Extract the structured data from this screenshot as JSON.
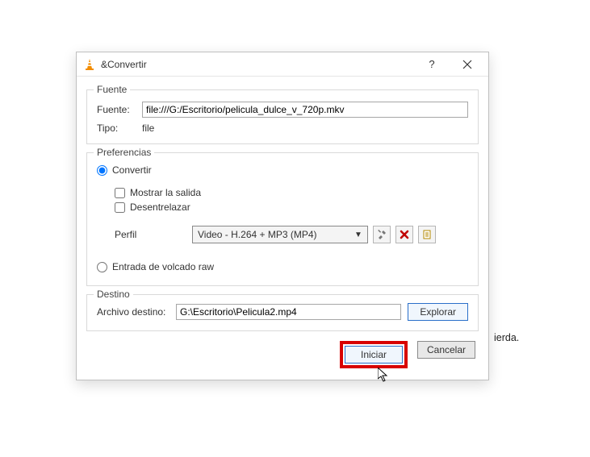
{
  "window": {
    "title": "&Convertir"
  },
  "fuente": {
    "group": "Fuente",
    "label": "Fuente:",
    "value": "file:///G:/Escritorio/pelicula_dulce_v_720p.mkv",
    "tipo_label": "Tipo:",
    "tipo_value": "file"
  },
  "pref": {
    "group": "Preferencias",
    "radio_convert": "Convertir",
    "chk_show_output": "Mostrar la salida",
    "chk_deinterlace": "Desentrelazar",
    "profile_label": "Perfil",
    "profile_value": "Video - H.264 + MP3 (MP4)",
    "radio_raw": "Entrada de volcado raw"
  },
  "icons": {
    "tools": "tools-icon",
    "delete": "delete-icon",
    "new": "new-profile-icon"
  },
  "dest": {
    "group": "Destino",
    "label": "Archivo destino:",
    "value": "G:\\Escritorio\\Pelicula2.mp4",
    "browse": "Explorar"
  },
  "footer": {
    "start": "Iniciar",
    "cancel": "Cancelar"
  },
  "behind": "ierda."
}
